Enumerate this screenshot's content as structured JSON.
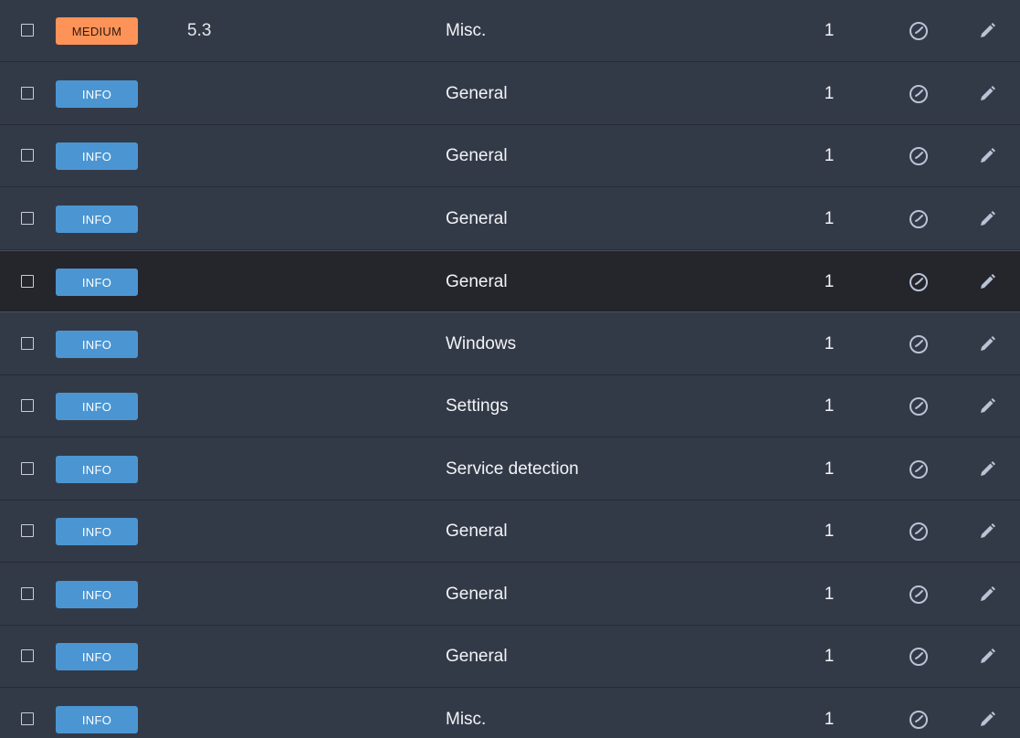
{
  "rows": [
    {
      "severity": "MEDIUM",
      "severity_class": "medium",
      "score": "5.3",
      "category": "Misc.",
      "count": "1"
    },
    {
      "severity": "INFO",
      "severity_class": "info",
      "score": "",
      "category": "General",
      "count": "1"
    },
    {
      "severity": "INFO",
      "severity_class": "info",
      "score": "",
      "category": "General",
      "count": "1"
    },
    {
      "severity": "INFO",
      "severity_class": "info",
      "score": "",
      "category": "General",
      "count": "1"
    },
    {
      "severity": "INFO",
      "severity_class": "info",
      "score": "",
      "category": "General",
      "count": "1",
      "highlighted": true
    },
    {
      "severity": "INFO",
      "severity_class": "info",
      "score": "",
      "category": "Windows",
      "count": "1"
    },
    {
      "severity": "INFO",
      "severity_class": "info",
      "score": "",
      "category": "Settings",
      "count": "1"
    },
    {
      "severity": "INFO",
      "severity_class": "info",
      "score": "",
      "category": "Service detection",
      "count": "1"
    },
    {
      "severity": "INFO",
      "severity_class": "info",
      "score": "",
      "category": "General",
      "count": "1"
    },
    {
      "severity": "INFO",
      "severity_class": "info",
      "score": "",
      "category": "General",
      "count": "1"
    },
    {
      "severity": "INFO",
      "severity_class": "info",
      "score": "",
      "category": "General",
      "count": "1"
    },
    {
      "severity": "INFO",
      "severity_class": "info",
      "score": "",
      "category": "Misc.",
      "count": "1"
    }
  ],
  "icons": {
    "row_checkbox": "checkbox-icon",
    "snooze": "clock-icon",
    "edit": "pencil-icon"
  },
  "colors": {
    "background": "#333a47",
    "highlight_row": "#25252c",
    "info_badge": "#4b96d2",
    "medium_badge": "#fd9358",
    "icon": "#b9c3d6"
  }
}
